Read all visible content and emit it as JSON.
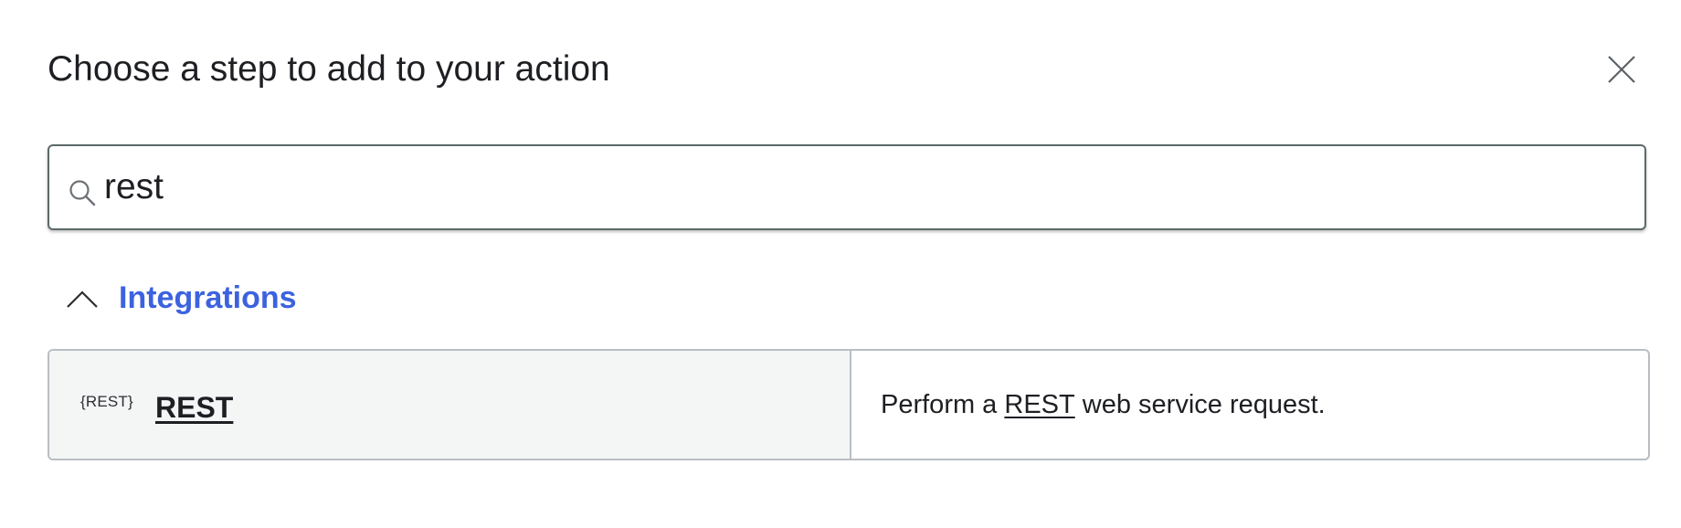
{
  "dialog": {
    "title": "Choose a step to add to your action",
    "close_icon": "close-icon"
  },
  "search": {
    "value": "rest",
    "icon": "search-icon"
  },
  "group": {
    "label": "Integrations",
    "expanded": true,
    "icon": "chevron-up-icon",
    "accent_color": "#3c62df"
  },
  "results": [
    {
      "icon_text": "{REST}",
      "name": "REST",
      "description_prefix": "Perform a ",
      "description_link": "REST",
      "description_suffix": " web service request."
    }
  ]
}
